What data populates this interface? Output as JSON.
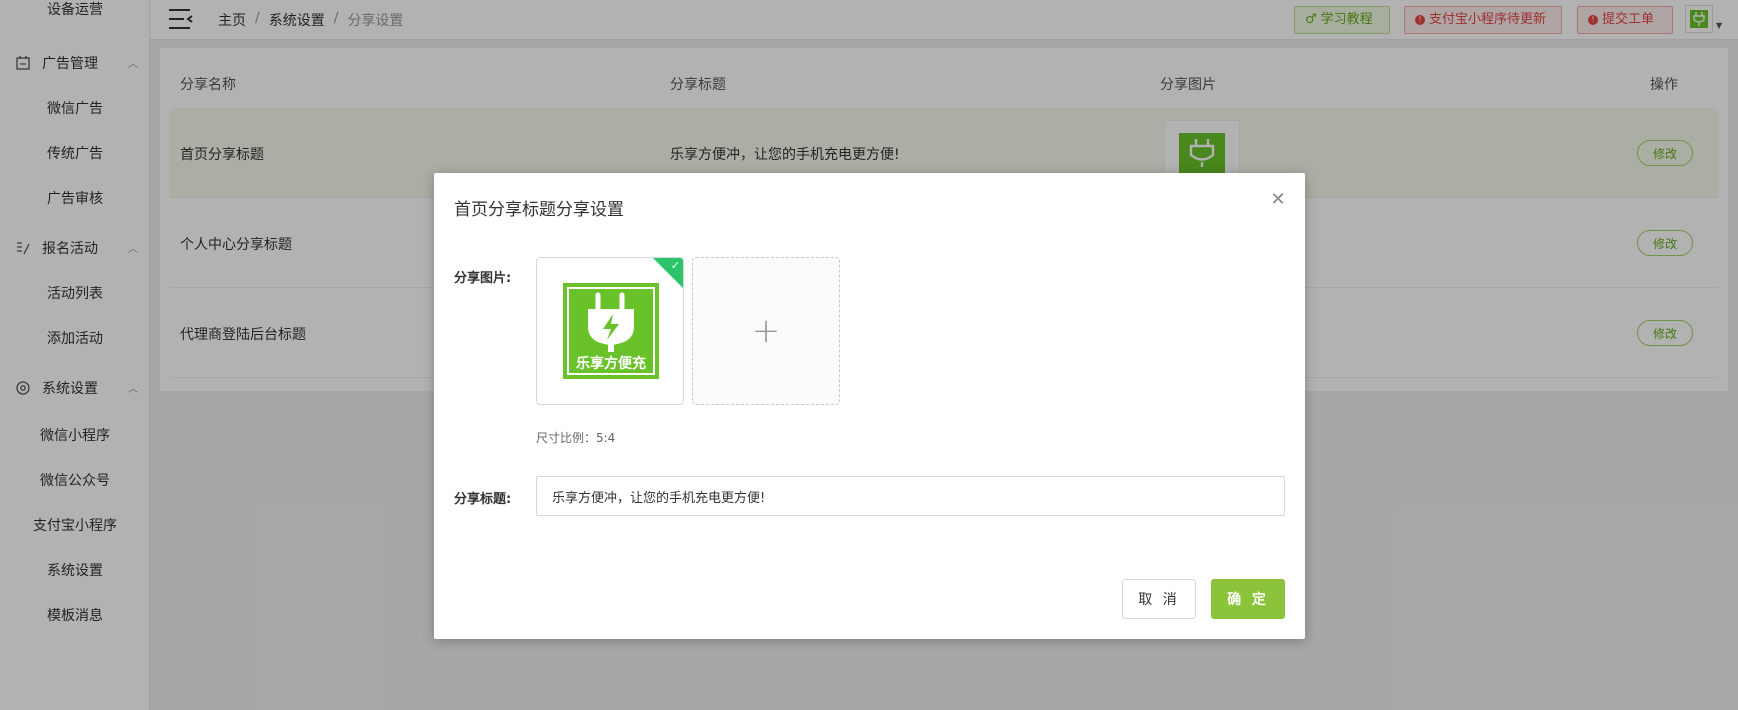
{
  "sidebar": {
    "top_item": "设备运营",
    "groups": [
      {
        "label": "广告管理",
        "icon": "ad-management-icon",
        "items": [
          "微信广告",
          "传统广告",
          "广告审核"
        ]
      },
      {
        "label": "报名活动",
        "icon": "signup-activity-icon",
        "items": [
          "活动列表",
          "添加活动"
        ]
      },
      {
        "label": "系统设置",
        "icon": "gear-icon",
        "items": [
          "微信小程序",
          "微信公众号",
          "支付宝小程序",
          "系统设置",
          "模板消息"
        ]
      }
    ]
  },
  "header": {
    "breadcrumb": [
      "主页",
      "系统设置",
      "分享设置"
    ],
    "buttons": {
      "tutorial": "学习教程",
      "alipay_update": "支付宝小程序待更新",
      "ticket": "提交工单"
    }
  },
  "table": {
    "columns": [
      "分享名称",
      "分享标题",
      "分享图片",
      "操作"
    ],
    "rows": [
      {
        "name": "首页分享标题",
        "title": "乐享方便冲，让您的手机充电更方便!",
        "has_image": true,
        "action": "修改"
      },
      {
        "name": "个人中心分享标题",
        "title": "",
        "has_image": false,
        "action": "修改"
      },
      {
        "name": "代理商登陆后台标题",
        "title": "",
        "has_image": false,
        "action": "修改"
      }
    ]
  },
  "modal": {
    "title": "首页分享标题分享设置",
    "image_label": "分享图片:",
    "logo_text": "乐享方便充",
    "size_hint": "尺寸比例：5:4",
    "title_label": "分享标题:",
    "title_value": "乐享方便冲，让您的手机充电更方便!",
    "cancel": "取 消",
    "confirm": "确 定"
  },
  "colors": {
    "accent_green": "#8bc43a",
    "brand_logo_green": "#6ac22b",
    "selected_check": "#2bc46b",
    "alert_red": "#e24545"
  }
}
